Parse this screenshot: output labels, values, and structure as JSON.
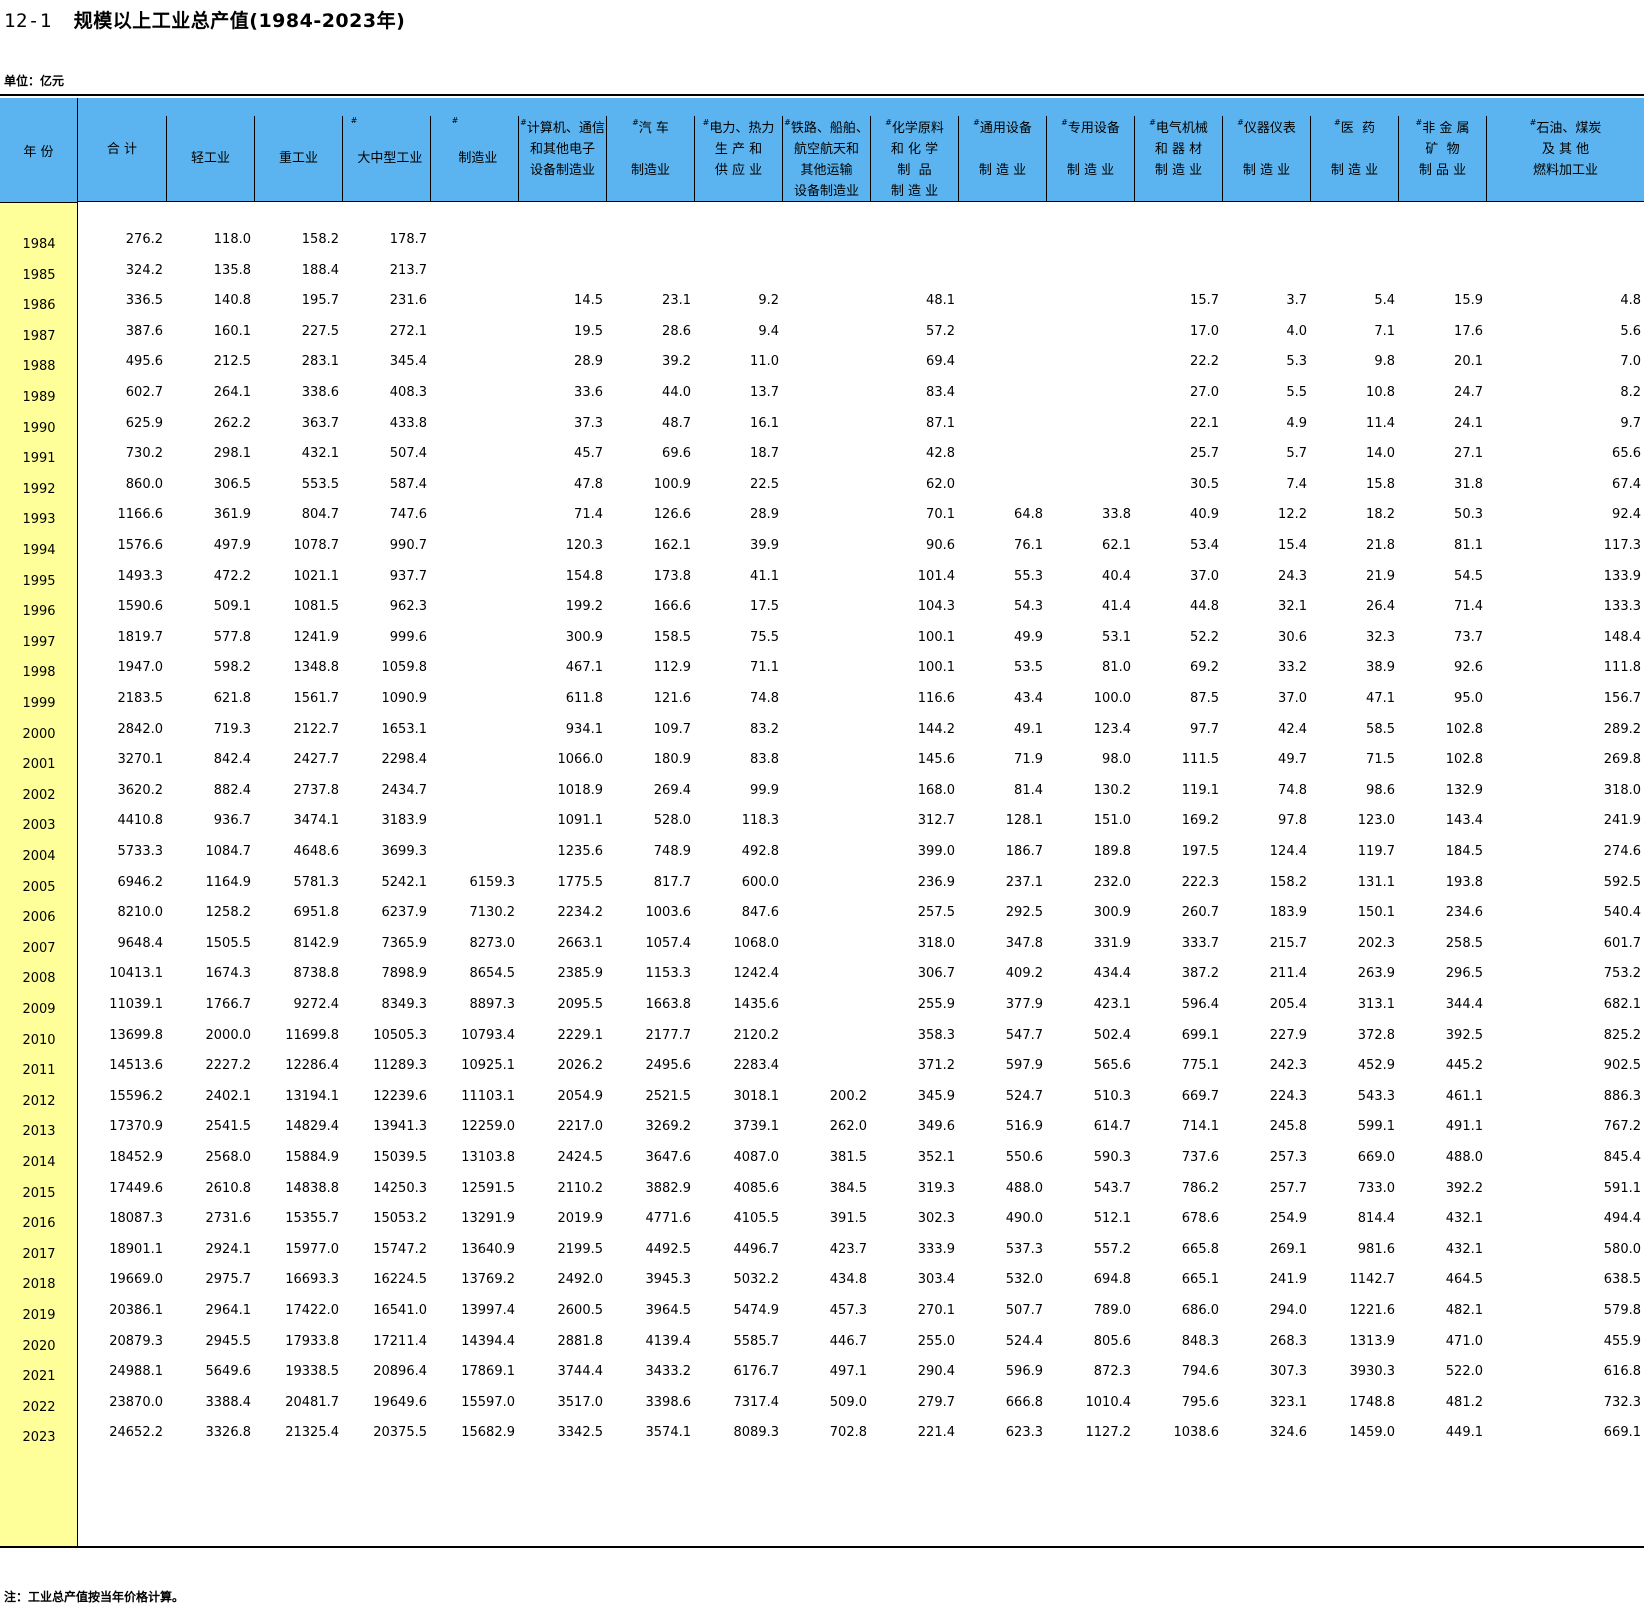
{
  "page": {
    "title_number": "12-1",
    "title_text": "规模以上工业总产值(1984-2023年)",
    "unit": "单位：亿元",
    "note": "注：工业总产值按当年价格计算。"
  },
  "columns": [
    {
      "key": "year",
      "label": "年 份"
    },
    {
      "key": "total",
      "label": "合 计"
    },
    {
      "key": "light",
      "label": "轻工业"
    },
    {
      "key": "heavy",
      "label": "重工业"
    },
    {
      "key": "large_medium",
      "label": "大中型工业",
      "mark": "#"
    },
    {
      "key": "manufacturing",
      "label": "制造业",
      "mark": "#"
    },
    {
      "key": "computer",
      "label": "计算机、通信\n和其他电子\n设备制造业",
      "mark": "#"
    },
    {
      "key": "auto",
      "label": "汽 车\n\n制造业",
      "mark": "#"
    },
    {
      "key": "power",
      "label": "电力、热力\n生 产 和\n供 应 业",
      "mark": "#"
    },
    {
      "key": "rail",
      "label": "铁路、船舶、\n航空航天和\n其他运输\n设备制造业",
      "mark": "#"
    },
    {
      "key": "chemical",
      "label": "化学原料\n和 化 学\n制  品\n制 造 业",
      "mark": "#"
    },
    {
      "key": "general_equip",
      "label": "通用设备\n\n制 造 业",
      "mark": "#"
    },
    {
      "key": "special_equip",
      "label": "专用设备\n\n制 造 业",
      "mark": "#"
    },
    {
      "key": "electrical",
      "label": "电气机械\n和 器 材\n制 造 业",
      "mark": "#"
    },
    {
      "key": "instrument",
      "label": "仪器仪表\n\n制 造 业",
      "mark": "#"
    },
    {
      "key": "medicine",
      "label": "医  药\n\n制 造 业",
      "mark": "#"
    },
    {
      "key": "nonmetal",
      "label": "非 金 属\n矿  物\n制 品 业",
      "mark": "#"
    },
    {
      "key": "petroleum",
      "label": "石油、煤炭\n及 其 他\n燃料加工业",
      "mark": "#"
    }
  ],
  "rows": [
    [
      "1984",
      "276.2",
      "118.0",
      "158.2",
      "178.7",
      "",
      "",
      "",
      "",
      "",
      "",
      "",
      "",
      "",
      "",
      "",
      "",
      ""
    ],
    [
      "1985",
      "324.2",
      "135.8",
      "188.4",
      "213.7",
      "",
      "",
      "",
      "",
      "",
      "",
      "",
      "",
      "",
      "",
      "",
      "",
      ""
    ],
    [
      "1986",
      "336.5",
      "140.8",
      "195.7",
      "231.6",
      "",
      "14.5",
      "23.1",
      "9.2",
      "",
      "48.1",
      "",
      "",
      "15.7",
      "3.7",
      "5.4",
      "15.9",
      "4.8"
    ],
    [
      "1987",
      "387.6",
      "160.1",
      "227.5",
      "272.1",
      "",
      "19.5",
      "28.6",
      "9.4",
      "",
      "57.2",
      "",
      "",
      "17.0",
      "4.0",
      "7.1",
      "17.6",
      "5.6"
    ],
    [
      "1988",
      "495.6",
      "212.5",
      "283.1",
      "345.4",
      "",
      "28.9",
      "39.2",
      "11.0",
      "",
      "69.4",
      "",
      "",
      "22.2",
      "5.3",
      "9.8",
      "20.1",
      "7.0"
    ],
    [
      "1989",
      "602.7",
      "264.1",
      "338.6",
      "408.3",
      "",
      "33.6",
      "44.0",
      "13.7",
      "",
      "83.4",
      "",
      "",
      "27.0",
      "5.5",
      "10.8",
      "24.7",
      "8.2"
    ],
    [
      "1990",
      "625.9",
      "262.2",
      "363.7",
      "433.8",
      "",
      "37.3",
      "48.7",
      "16.1",
      "",
      "87.1",
      "",
      "",
      "22.1",
      "4.9",
      "11.4",
      "24.1",
      "9.7"
    ],
    [
      "1991",
      "730.2",
      "298.1",
      "432.1",
      "507.4",
      "",
      "45.7",
      "69.6",
      "18.7",
      "",
      "42.8",
      "",
      "",
      "25.7",
      "5.7",
      "14.0",
      "27.1",
      "65.6"
    ],
    [
      "1992",
      "860.0",
      "306.5",
      "553.5",
      "587.4",
      "",
      "47.8",
      "100.9",
      "22.5",
      "",
      "62.0",
      "",
      "",
      "30.5",
      "7.4",
      "15.8",
      "31.8",
      "67.4"
    ],
    [
      "1993",
      "1166.6",
      "361.9",
      "804.7",
      "747.6",
      "",
      "71.4",
      "126.6",
      "28.9",
      "",
      "70.1",
      "64.8",
      "33.8",
      "40.9",
      "12.2",
      "18.2",
      "50.3",
      "92.4"
    ],
    [
      "1994",
      "1576.6",
      "497.9",
      "1078.7",
      "990.7",
      "",
      "120.3",
      "162.1",
      "39.9",
      "",
      "90.6",
      "76.1",
      "62.1",
      "53.4",
      "15.4",
      "21.8",
      "81.1",
      "117.3"
    ],
    [
      "1995",
      "1493.3",
      "472.2",
      "1021.1",
      "937.7",
      "",
      "154.8",
      "173.8",
      "41.1",
      "",
      "101.4",
      "55.3",
      "40.4",
      "37.0",
      "24.3",
      "21.9",
      "54.5",
      "133.9"
    ],
    [
      "1996",
      "1590.6",
      "509.1",
      "1081.5",
      "962.3",
      "",
      "199.2",
      "166.6",
      "17.5",
      "",
      "104.3",
      "54.3",
      "41.4",
      "44.8",
      "32.1",
      "26.4",
      "71.4",
      "133.3"
    ],
    [
      "1997",
      "1819.7",
      "577.8",
      "1241.9",
      "999.6",
      "",
      "300.9",
      "158.5",
      "75.5",
      "",
      "100.1",
      "49.9",
      "53.1",
      "52.2",
      "30.6",
      "32.3",
      "73.7",
      "148.4"
    ],
    [
      "1998",
      "1947.0",
      "598.2",
      "1348.8",
      "1059.8",
      "",
      "467.1",
      "112.9",
      "71.1",
      "",
      "100.1",
      "53.5",
      "81.0",
      "69.2",
      "33.2",
      "38.9",
      "92.6",
      "111.8"
    ],
    [
      "1999",
      "2183.5",
      "621.8",
      "1561.7",
      "1090.9",
      "",
      "611.8",
      "121.6",
      "74.8",
      "",
      "116.6",
      "43.4",
      "100.0",
      "87.5",
      "37.0",
      "47.1",
      "95.0",
      "156.7"
    ],
    [
      "2000",
      "2842.0",
      "719.3",
      "2122.7",
      "1653.1",
      "",
      "934.1",
      "109.7",
      "83.2",
      "",
      "144.2",
      "49.1",
      "123.4",
      "97.7",
      "42.4",
      "58.5",
      "102.8",
      "289.2"
    ],
    [
      "2001",
      "3270.1",
      "842.4",
      "2427.7",
      "2298.4",
      "",
      "1066.0",
      "180.9",
      "83.8",
      "",
      "145.6",
      "71.9",
      "98.0",
      "111.5",
      "49.7",
      "71.5",
      "102.8",
      "269.8"
    ],
    [
      "2002",
      "3620.2",
      "882.4",
      "2737.8",
      "2434.7",
      "",
      "1018.9",
      "269.4",
      "99.9",
      "",
      "168.0",
      "81.4",
      "130.2",
      "119.1",
      "74.8",
      "98.6",
      "132.9",
      "318.0"
    ],
    [
      "2003",
      "4410.8",
      "936.7",
      "3474.1",
      "3183.9",
      "",
      "1091.1",
      "528.0",
      "118.3",
      "",
      "312.7",
      "128.1",
      "151.0",
      "169.2",
      "97.8",
      "123.0",
      "143.4",
      "241.9"
    ],
    [
      "2004",
      "5733.3",
      "1084.7",
      "4648.6",
      "3699.3",
      "",
      "1235.6",
      "748.9",
      "492.8",
      "",
      "399.0",
      "186.7",
      "189.8",
      "197.5",
      "124.4",
      "119.7",
      "184.5",
      "274.6"
    ],
    [
      "2005",
      "6946.2",
      "1164.9",
      "5781.3",
      "5242.1",
      "6159.3",
      "1775.5",
      "817.7",
      "600.0",
      "",
      "236.9",
      "237.1",
      "232.0",
      "222.3",
      "158.2",
      "131.1",
      "193.8",
      "592.5"
    ],
    [
      "2006",
      "8210.0",
      "1258.2",
      "6951.8",
      "6237.9",
      "7130.2",
      "2234.2",
      "1003.6",
      "847.6",
      "",
      "257.5",
      "292.5",
      "300.9",
      "260.7",
      "183.9",
      "150.1",
      "234.6",
      "540.4"
    ],
    [
      "2007",
      "9648.4",
      "1505.5",
      "8142.9",
      "7365.9",
      "8273.0",
      "2663.1",
      "1057.4",
      "1068.0",
      "",
      "318.0",
      "347.8",
      "331.9",
      "333.7",
      "215.7",
      "202.3",
      "258.5",
      "601.7"
    ],
    [
      "2008",
      "10413.1",
      "1674.3",
      "8738.8",
      "7898.9",
      "8654.5",
      "2385.9",
      "1153.3",
      "1242.4",
      "",
      "306.7",
      "409.2",
      "434.4",
      "387.2",
      "211.4",
      "263.9",
      "296.5",
      "753.2"
    ],
    [
      "2009",
      "11039.1",
      "1766.7",
      "9272.4",
      "8349.3",
      "8897.3",
      "2095.5",
      "1663.8",
      "1435.6",
      "",
      "255.9",
      "377.9",
      "423.1",
      "596.4",
      "205.4",
      "313.1",
      "344.4",
      "682.1"
    ],
    [
      "2010",
      "13699.8",
      "2000.0",
      "11699.8",
      "10505.3",
      "10793.4",
      "2229.1",
      "2177.7",
      "2120.2",
      "",
      "358.3",
      "547.7",
      "502.4",
      "699.1",
      "227.9",
      "372.8",
      "392.5",
      "825.2"
    ],
    [
      "2011",
      "14513.6",
      "2227.2",
      "12286.4",
      "11289.3",
      "10925.1",
      "2026.2",
      "2495.6",
      "2283.4",
      "",
      "371.2",
      "597.9",
      "565.6",
      "775.1",
      "242.3",
      "452.9",
      "445.2",
      "902.5"
    ],
    [
      "2012",
      "15596.2",
      "2402.1",
      "13194.1",
      "12239.6",
      "11103.1",
      "2054.9",
      "2521.5",
      "3018.1",
      "200.2",
      "345.9",
      "524.7",
      "510.3",
      "669.7",
      "224.3",
      "543.3",
      "461.1",
      "886.3"
    ],
    [
      "2013",
      "17370.9",
      "2541.5",
      "14829.4",
      "13941.3",
      "12259.0",
      "2217.0",
      "3269.2",
      "3739.1",
      "262.0",
      "349.6",
      "516.9",
      "614.7",
      "714.1",
      "245.8",
      "599.1",
      "491.1",
      "767.2"
    ],
    [
      "2014",
      "18452.9",
      "2568.0",
      "15884.9",
      "15039.5",
      "13103.8",
      "2424.5",
      "3647.6",
      "4087.0",
      "381.5",
      "352.1",
      "550.6",
      "590.3",
      "737.6",
      "257.3",
      "669.0",
      "488.0",
      "845.4"
    ],
    [
      "2015",
      "17449.6",
      "2610.8",
      "14838.8",
      "14250.3",
      "12591.5",
      "2110.2",
      "3882.9",
      "4085.6",
      "384.5",
      "319.3",
      "488.0",
      "543.7",
      "786.2",
      "257.7",
      "733.0",
      "392.2",
      "591.1"
    ],
    [
      "2016",
      "18087.3",
      "2731.6",
      "15355.7",
      "15053.2",
      "13291.9",
      "2019.9",
      "4771.6",
      "4105.5",
      "391.5",
      "302.3",
      "490.0",
      "512.1",
      "678.6",
      "254.9",
      "814.4",
      "432.1",
      "494.4"
    ],
    [
      "2017",
      "18901.1",
      "2924.1",
      "15977.0",
      "15747.2",
      "13640.9",
      "2199.5",
      "4492.5",
      "4496.7",
      "423.7",
      "333.9",
      "537.3",
      "557.2",
      "665.8",
      "269.1",
      "981.6",
      "432.1",
      "580.0"
    ],
    [
      "2018",
      "19669.0",
      "2975.7",
      "16693.3",
      "16224.5",
      "13769.2",
      "2492.0",
      "3945.3",
      "5032.2",
      "434.8",
      "303.4",
      "532.0",
      "694.8",
      "665.1",
      "241.9",
      "1142.7",
      "464.5",
      "638.5"
    ],
    [
      "2019",
      "20386.1",
      "2964.1",
      "17422.0",
      "16541.0",
      "13997.4",
      "2600.5",
      "3964.5",
      "5474.9",
      "457.3",
      "270.1",
      "507.7",
      "789.0",
      "686.0",
      "294.0",
      "1221.6",
      "482.1",
      "579.8"
    ],
    [
      "2020",
      "20879.3",
      "2945.5",
      "17933.8",
      "17211.4",
      "14394.4",
      "2881.8",
      "4139.4",
      "5585.7",
      "446.7",
      "255.0",
      "524.4",
      "805.6",
      "848.3",
      "268.3",
      "1313.9",
      "471.0",
      "455.9"
    ],
    [
      "2021",
      "24988.1",
      "5649.6",
      "19338.5",
      "20896.4",
      "17869.1",
      "3744.4",
      "3433.2",
      "6176.7",
      "497.1",
      "290.4",
      "596.9",
      "872.3",
      "794.6",
      "307.3",
      "3930.3",
      "522.0",
      "616.8"
    ],
    [
      "2022",
      "23870.0",
      "3388.4",
      "20481.7",
      "19649.6",
      "15597.0",
      "3517.0",
      "3398.6",
      "7317.4",
      "509.0",
      "279.7",
      "666.8",
      "1010.4",
      "795.6",
      "323.1",
      "1748.8",
      "481.2",
      "732.3"
    ],
    [
      "2023",
      "24652.2",
      "3326.8",
      "21325.4",
      "20375.5",
      "15682.9",
      "3342.5",
      "3574.1",
      "8089.3",
      "702.8",
      "221.4",
      "623.3",
      "1127.2",
      "1038.6",
      "324.6",
      "1459.0",
      "449.1",
      "669.1"
    ]
  ]
}
